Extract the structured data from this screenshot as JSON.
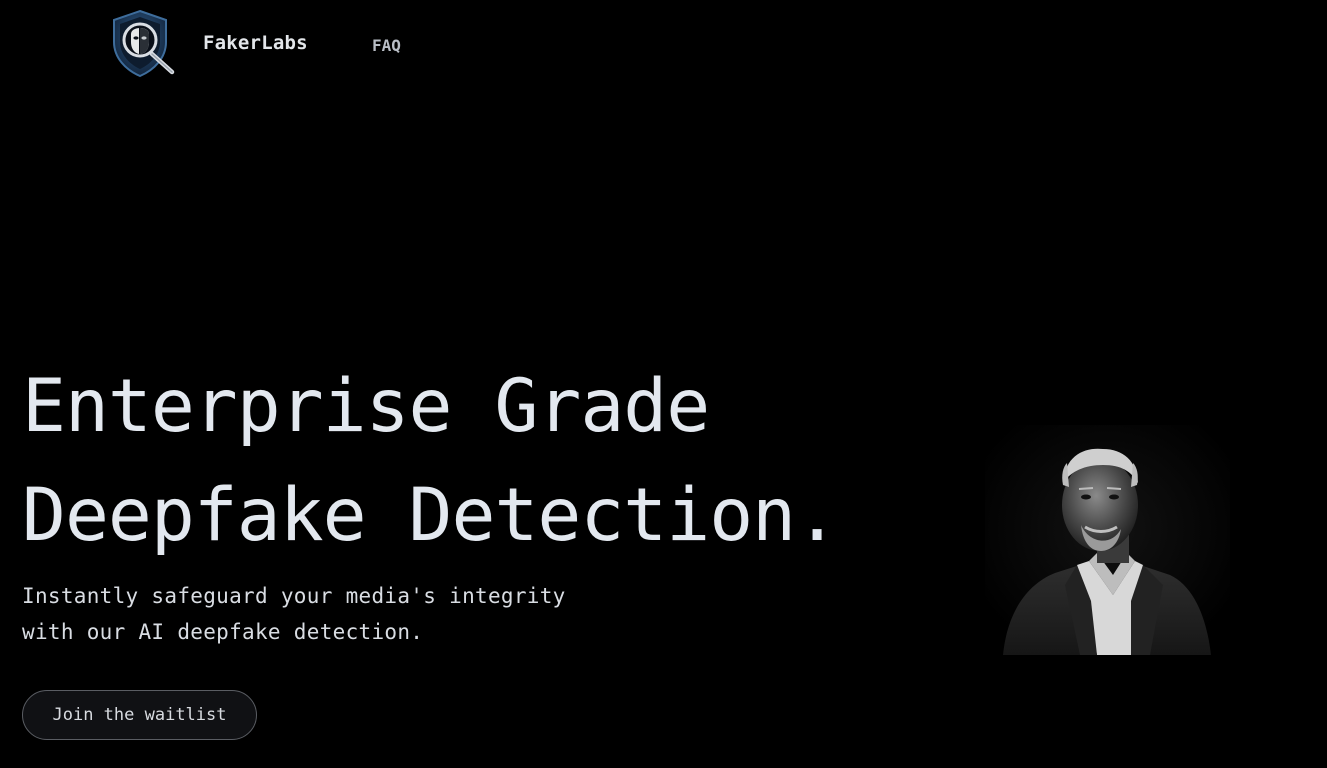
{
  "nav": {
    "logo_icon": "shield-magnifier-face-icon",
    "brand": "FakerLabs",
    "links": [
      {
        "label": "FAQ"
      }
    ]
  },
  "hero": {
    "title_lines": [
      "Enterprise Grade",
      "Deepfake Detection."
    ],
    "subtitle_lines": [
      "Instantly safeguard your media's integrity",
      "with our AI deepfake detection."
    ],
    "cta_label": "Join the waitlist",
    "image": "black-and-white-portrait-man-in-suit"
  },
  "colors": {
    "background": "#000000",
    "text": "#e3e8ef",
    "muted": "#b9bec6",
    "logo_shield": "#1e3a5f"
  }
}
